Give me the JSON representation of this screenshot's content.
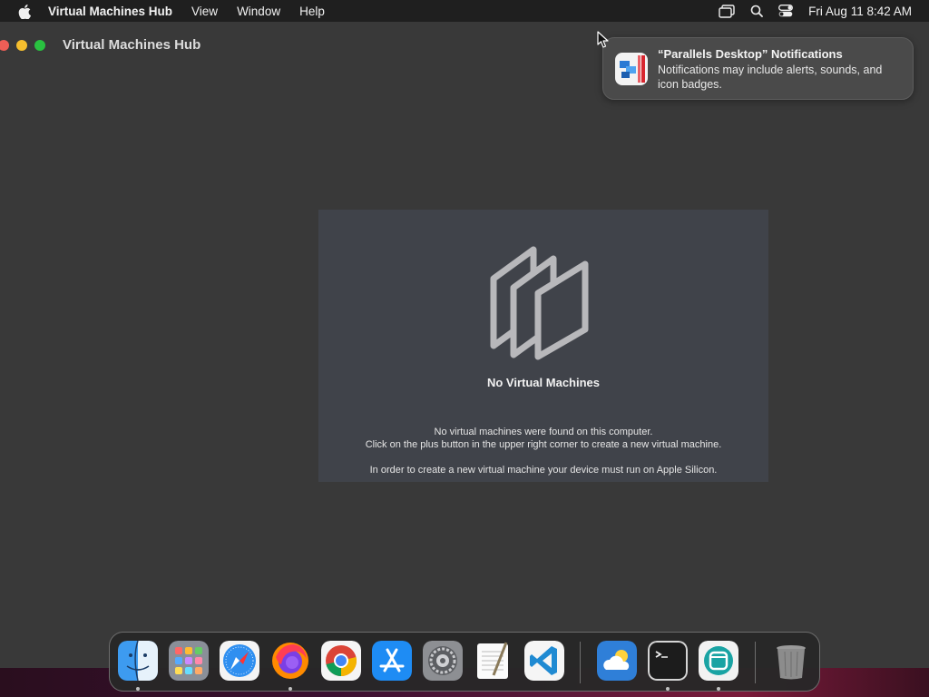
{
  "menubar": {
    "app_name": "Virtual Machines Hub",
    "items": [
      "View",
      "Window",
      "Help"
    ],
    "clock": "Fri Aug 11  8:42 AM"
  },
  "window": {
    "title": "Virtual Machines Hub"
  },
  "empty_state": {
    "title": "No Virtual Machines",
    "line1": "No virtual machines were found on this computer.",
    "line2": "Click on the plus button in the upper right corner to create a new virtual machine.",
    "line3": "In order to create a new virtual machine your device must run on Apple Silicon."
  },
  "notification": {
    "title": "“Parallels Desktop” Notifications",
    "body": "Notifications may include alerts, sounds, and icon badges."
  },
  "dock": {
    "items": [
      {
        "name": "finder-icon",
        "running": true
      },
      {
        "name": "launchpad-icon",
        "running": false
      },
      {
        "name": "safari-icon",
        "running": false
      },
      {
        "name": "firefox-icon",
        "running": true
      },
      {
        "name": "chrome-icon",
        "running": false
      },
      {
        "name": "app-store-icon",
        "running": false
      },
      {
        "name": "system-settings-icon",
        "running": false
      },
      {
        "name": "textedit-icon",
        "running": false
      },
      {
        "name": "vscode-icon",
        "running": false
      },
      {
        "name": "weather-icon",
        "running": false
      },
      {
        "name": "terminal-icon",
        "running": true
      },
      {
        "name": "virtual-machines-hub-icon",
        "running": true
      },
      {
        "name": "trash-icon",
        "running": false
      }
    ]
  },
  "colors": {
    "menubar_bg": "#1f1f1f",
    "window_bg": "#393939",
    "panel_bg": "#40434a",
    "close": "#ee5e56",
    "minimize": "#f5be2e",
    "maximize": "#29c140"
  }
}
